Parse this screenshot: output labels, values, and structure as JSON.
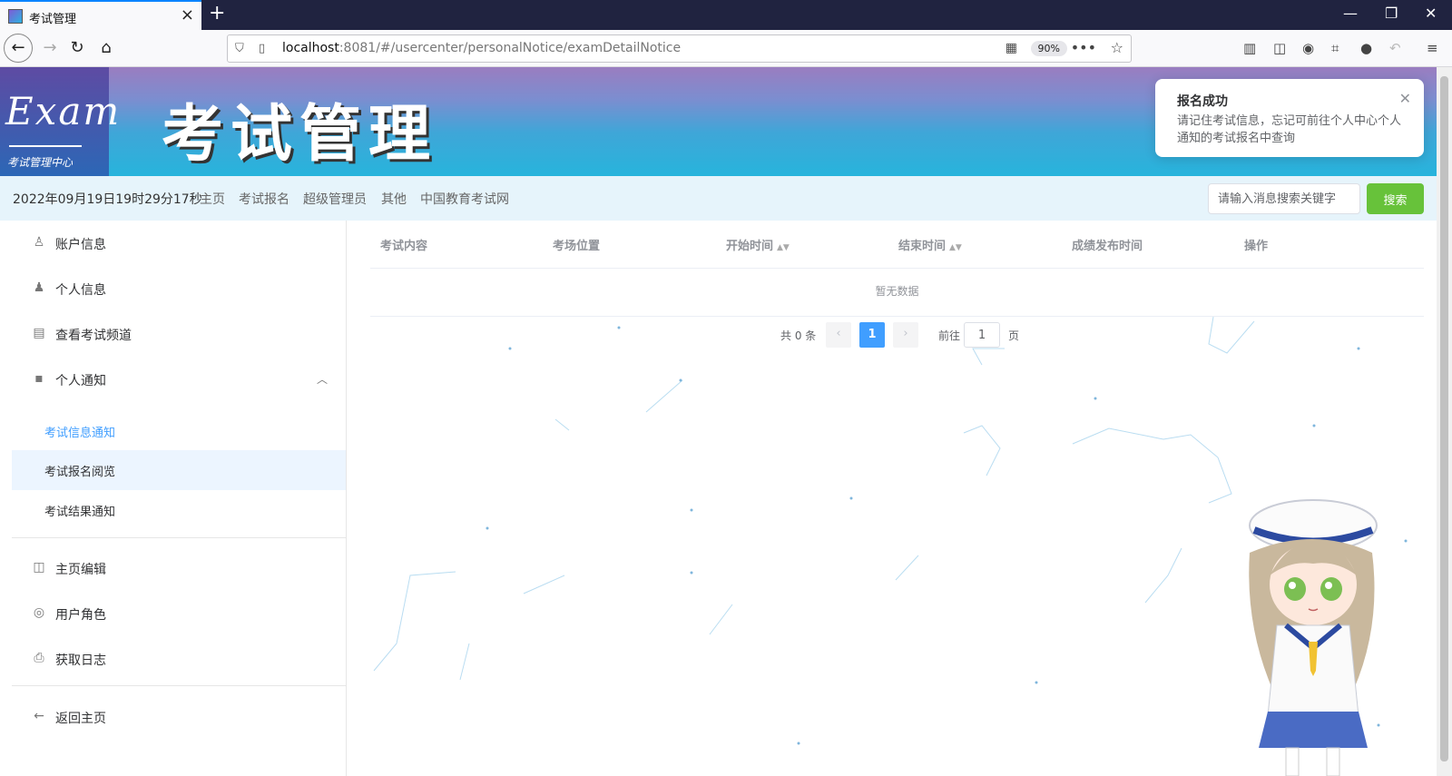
{
  "browser": {
    "tab_title": "考试管理",
    "url_host": "localhost",
    "url_rest": ":8081/#/usercenter/personalNotice/examDetailNotice",
    "zoom": "90%"
  },
  "banner": {
    "logo_text": "Exam",
    "logo_sub": "考试管理中心",
    "title": "考试管理"
  },
  "notification": {
    "title": "报名成功",
    "body": "请记住考试信息，忘记可前往个人中心个人通知的考试报名中查询"
  },
  "menubar": {
    "datetime": "2022年09月19日19时29分17秒",
    "links": [
      "主页",
      "考试报名",
      "超级管理员",
      "其他",
      "中国教育考试网"
    ],
    "search_placeholder": "请输入消息搜索关键字",
    "search_button": "搜索"
  },
  "sidebar": {
    "items": [
      {
        "label": "账户信息",
        "icon": "user-outline-icon"
      },
      {
        "label": "个人信息",
        "icon": "user-solid-icon"
      },
      {
        "label": "查看考试频道",
        "icon": "clipboard-icon"
      },
      {
        "label": "个人通知",
        "icon": "chat-icon"
      }
    ],
    "sub_items": [
      {
        "label": "考试信息通知",
        "active": true
      },
      {
        "label": "考试报名阅览",
        "active": false
      },
      {
        "label": "考试结果通知",
        "active": false
      }
    ],
    "items2": [
      {
        "label": "主页编辑",
        "icon": "book-icon"
      },
      {
        "label": "用户角色",
        "icon": "role-icon"
      },
      {
        "label": "获取日志",
        "icon": "printer-icon"
      }
    ],
    "back_label": "返回主页"
  },
  "table": {
    "columns": [
      "考试内容",
      "考场位置",
      "开始时间",
      "结束时间",
      "成绩发布时间",
      "操作"
    ],
    "empty_text": "暂无数据"
  },
  "pagination": {
    "total": "共 0 条",
    "current_page": "1",
    "goto_label": "前往",
    "goto_value": "1",
    "page_unit": "页"
  },
  "colors": {
    "accent": "#409eff",
    "search_button": "#67c23a",
    "menubar_bg": "#e6f4fb"
  }
}
